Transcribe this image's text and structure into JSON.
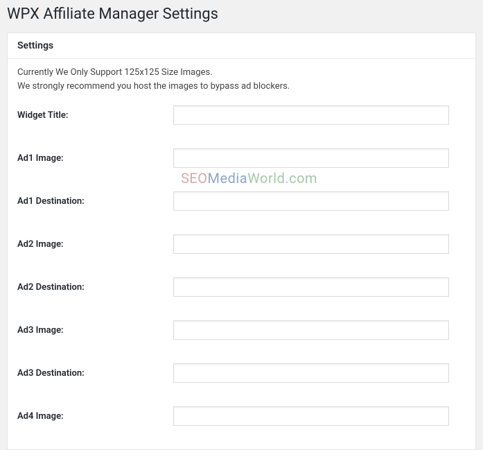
{
  "page": {
    "title": "WPX Affiliate Manager Settings"
  },
  "panel": {
    "header": "Settings",
    "notice_line1": "Currently We Only Support 125x125 Size Images.",
    "notice_line2": "We strongly recommend you host the images to bypass ad blockers."
  },
  "fields": {
    "widget_title": {
      "label": "Widget Title:",
      "value": ""
    },
    "ad1_image": {
      "label": "Ad1 Image:",
      "value": ""
    },
    "ad1_destination": {
      "label": "Ad1 Destination:",
      "value": ""
    },
    "ad2_image": {
      "label": "Ad2 Image:",
      "value": ""
    },
    "ad2_destination": {
      "label": "Ad2 Destination:",
      "value": ""
    },
    "ad3_image": {
      "label": "Ad3 Image:",
      "value": ""
    },
    "ad3_destination": {
      "label": "Ad3 Destination:",
      "value": ""
    },
    "ad4_image": {
      "label": "Ad4 Image:",
      "value": ""
    }
  },
  "watermark": {
    "seo": "SEO",
    "media": "Media",
    "world": "World.com"
  }
}
